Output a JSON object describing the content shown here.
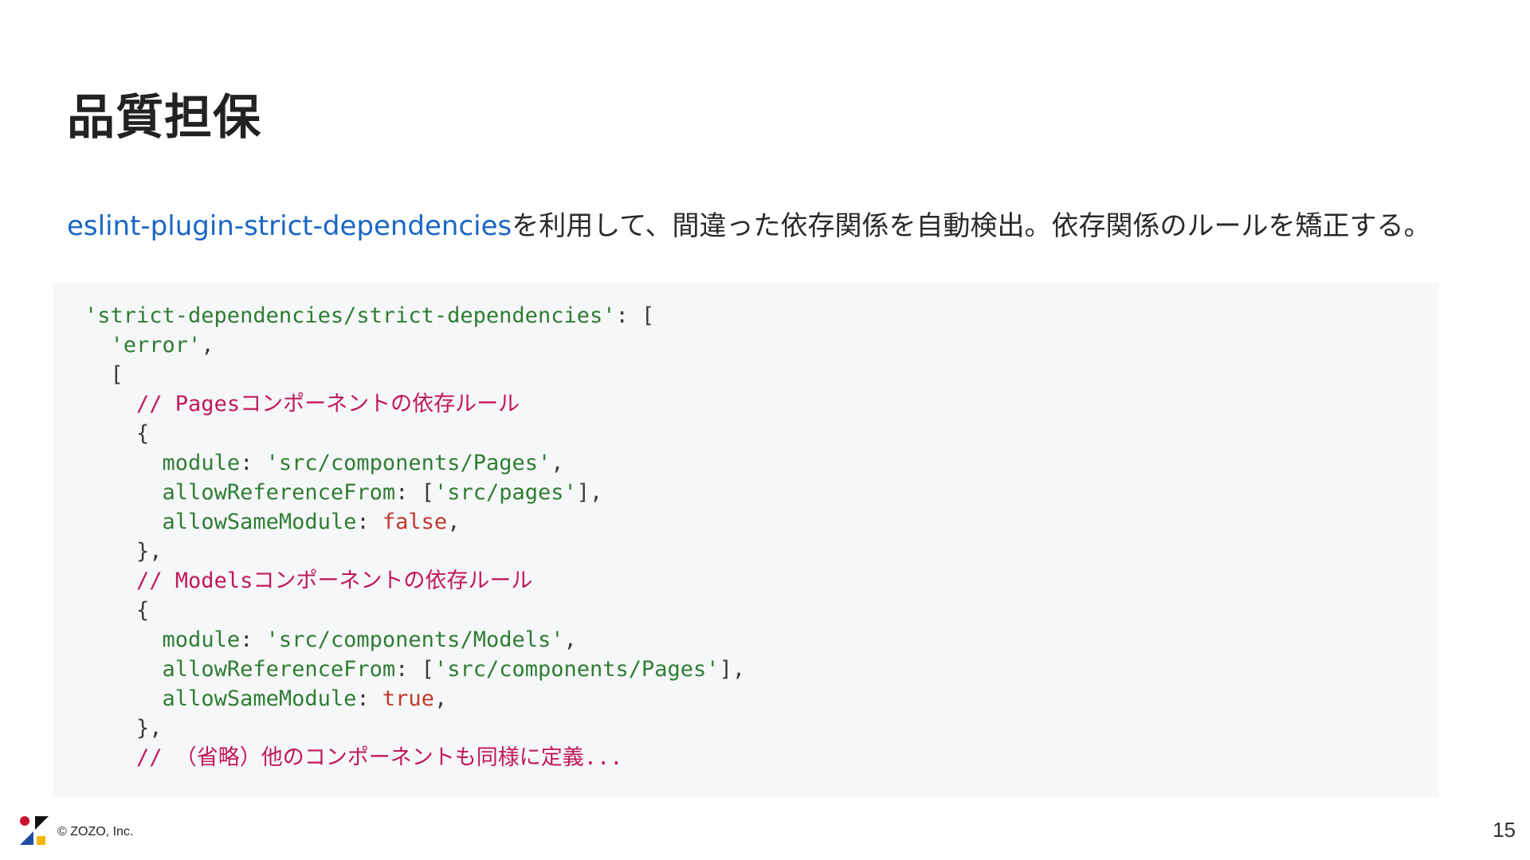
{
  "slide": {
    "title": "品質担保",
    "intro_link": "eslint-plugin-strict-dependencies",
    "intro_text": "を利用して、間違った依存関係を自動検出。依存関係のルールを矯正する。"
  },
  "code": {
    "line1_key": "'strict-dependencies/strict-dependencies'",
    "line1_rest": ": [",
    "line2_str": "'error'",
    "line2_rest": ",",
    "line3": "[",
    "comment_pages": "// Pagesコンポーネントの依存ルール",
    "open_brace": "{",
    "module_key": "module",
    "colon": ": ",
    "pages_module": "'src/components/Pages'",
    "comma": ",",
    "allow_ref_key": "allowReferenceFrom",
    "colon_bracket": ": [",
    "pages_ref": "'src/pages'",
    "close_bracket_comma": "],",
    "allow_same_key": "allowSameModule",
    "false_val": "false",
    "close_brace": "},",
    "comment_models": "// Modelsコンポーネントの依存ルール",
    "models_module": "'src/components/Models'",
    "models_ref": "'src/components/Pages'",
    "true_val": "true",
    "comment_others": "// （省略）他のコンポーネントも同様に定義..."
  },
  "footer": {
    "copyright": "© ZOZO, Inc.",
    "page_number": "15",
    "logo_colors": {
      "red": "#c8102e",
      "black": "#111111",
      "blue": "#1e4fa3",
      "yellow": "#f2b705"
    }
  }
}
